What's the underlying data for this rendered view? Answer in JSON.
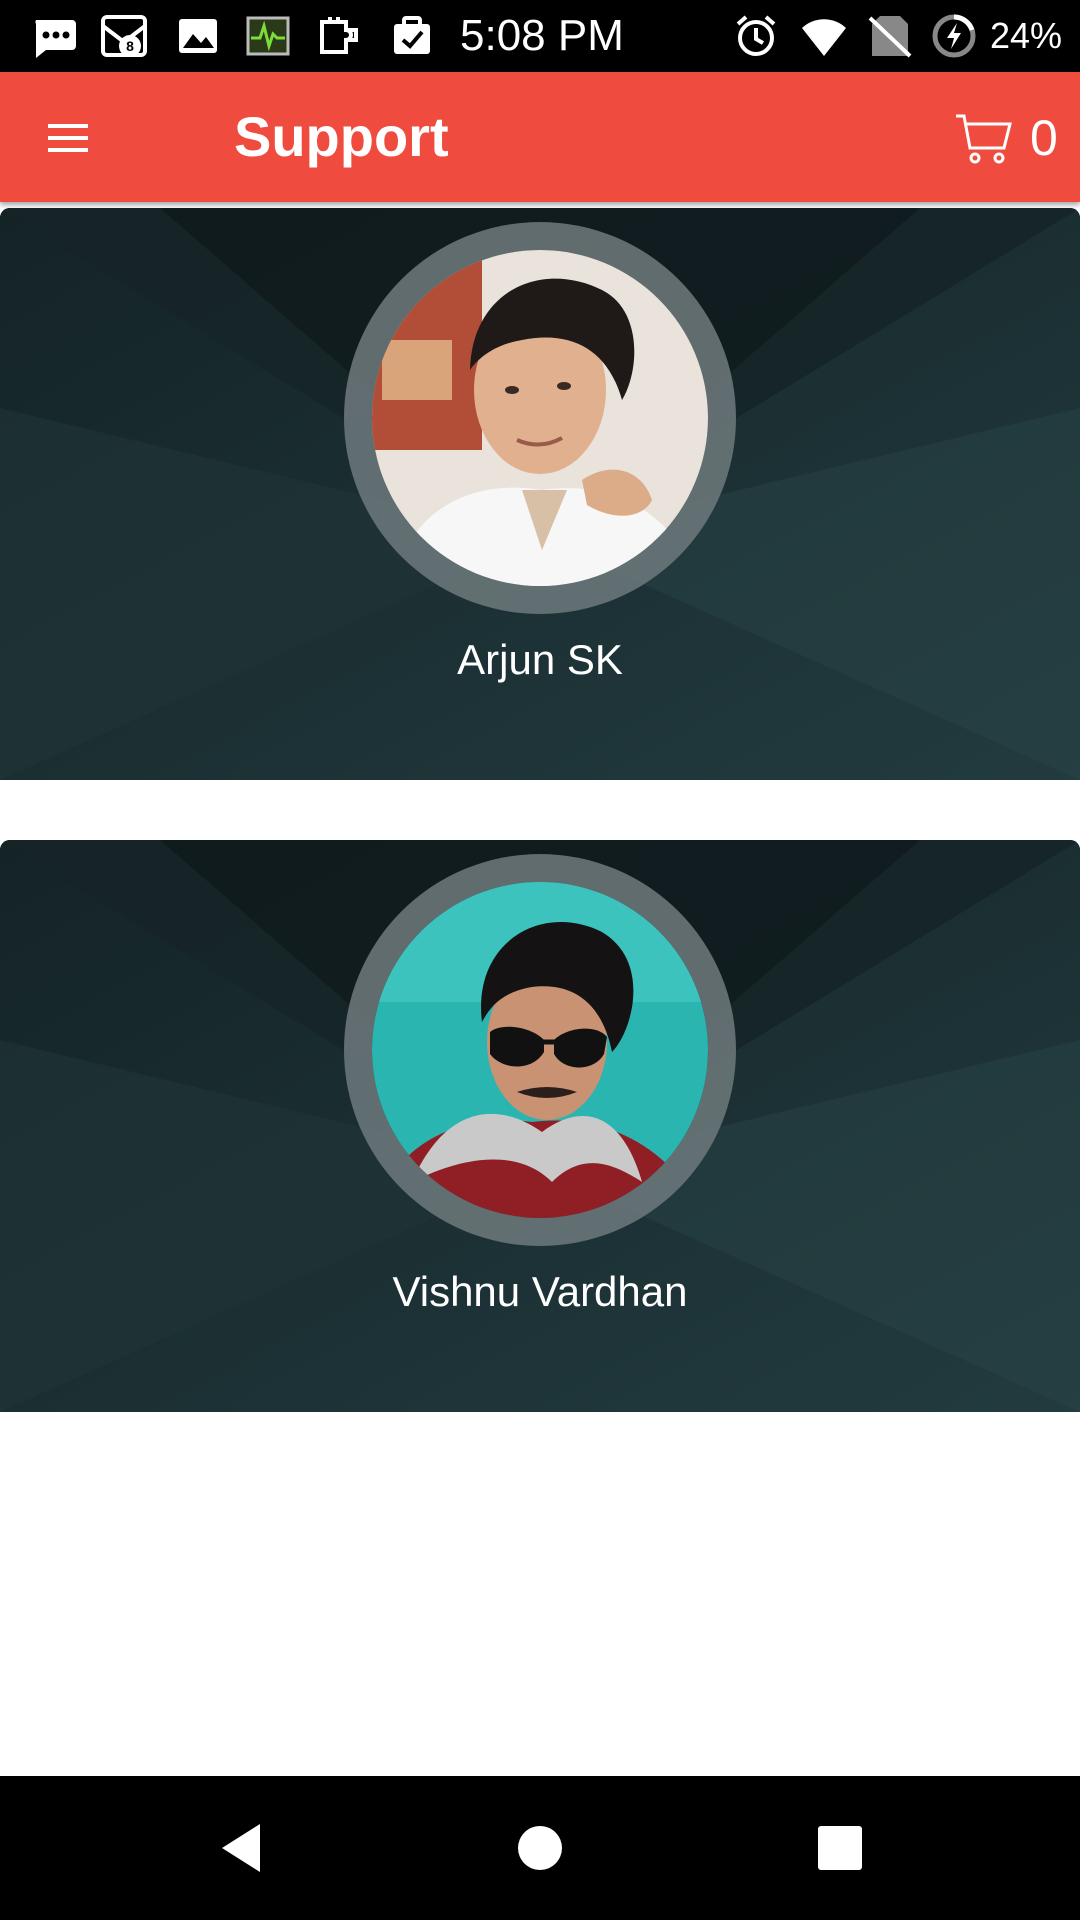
{
  "status_bar": {
    "time": "5:08 PM",
    "battery_percent": "24%",
    "notification_badge": "8",
    "icons": [
      "messenger-icon",
      "notification-8-icon",
      "gallery-icon",
      "activity-monitor-icon",
      "plugin-icon",
      "task-icon",
      "alarm-icon",
      "wifi-icon",
      "no-sim-icon",
      "battery-charging-icon"
    ]
  },
  "app_bar": {
    "title": "Support",
    "cart_count": "0",
    "background_color": "#ef4b3f"
  },
  "support_contacts": [
    {
      "name": "Arjun SK",
      "avatar": "avatar-photo-man-white-shirt"
    },
    {
      "name": "Vishnu Vardhan",
      "avatar": "avatar-photo-man-sunglasses"
    }
  ],
  "nav_bar": {
    "buttons": [
      "back-icon",
      "home-icon",
      "recents-icon"
    ]
  }
}
